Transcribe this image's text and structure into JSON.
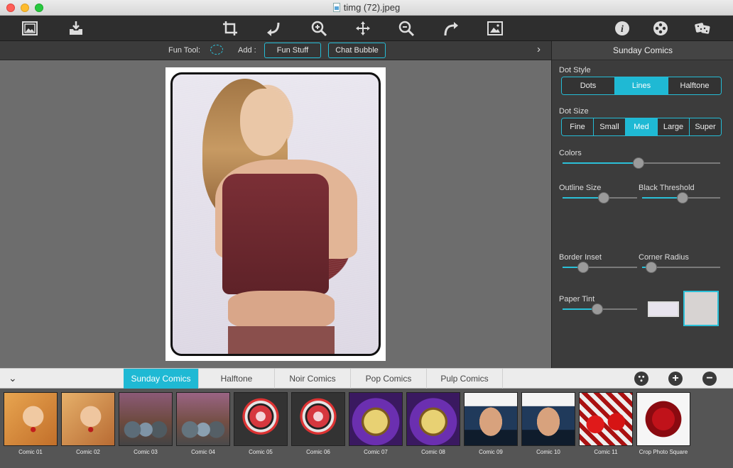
{
  "window": {
    "title": "timg (72).jpeg"
  },
  "toolbar": {
    "icons": [
      "photo-open-icon",
      "save-download-icon",
      "crop-icon",
      "rotate-left-icon",
      "zoom-in-icon",
      "move-icon",
      "zoom-out-icon",
      "rotate-right-icon",
      "fit-image-icon",
      "info-icon",
      "settings-film-icon",
      "random-dice-icon"
    ]
  },
  "funbar": {
    "fun_tool_label": "Fun Tool:",
    "add_label": "Add :",
    "fun_stuff": "Fun Stuff",
    "chat_bubble": "Chat Bubble",
    "expand_glyph": "›"
  },
  "panel": {
    "title": "Sunday Comics",
    "dot_style_label": "Dot Style",
    "dot_style_options": [
      "Dots",
      "Lines",
      "Halftone"
    ],
    "dot_style_selected": "Lines",
    "dot_size_label": "Dot Size",
    "dot_size_options": [
      "Fine",
      "Small",
      "Med",
      "Large",
      "Super"
    ],
    "dot_size_selected": "Med",
    "colors_label": "Colors",
    "colors_value": 0.48,
    "outline_size_label": "Outline Size",
    "outline_size_value": 0.55,
    "black_threshold_label": "Black Threshold",
    "black_threshold_value": 0.52,
    "border_inset_label": "Border Inset",
    "border_inset_value": 0.28,
    "corner_radius_label": "Corner Radius",
    "corner_radius_value": 0.12,
    "paper_tint_label": "Paper Tint",
    "paper_tint_value": 0.47,
    "paper_tint_color": "#e8e4ee",
    "texture_color": "#d7d3d2"
  },
  "tabs": {
    "collapse_glyph": "⌄",
    "items": [
      "Sunday Comics",
      "Halftone",
      "Noir Comics",
      "Pop Comics",
      "Pulp Comics"
    ],
    "active": "Sunday Comics",
    "add_glyph": "+",
    "remove_glyph": "−"
  },
  "thumbnails": [
    {
      "label": "Comic 01",
      "style": "th-face"
    },
    {
      "label": "Comic 02",
      "style": "th-face2"
    },
    {
      "label": "Comic 03",
      "style": "th-cans"
    },
    {
      "label": "Comic 04",
      "style": "th-cans2"
    },
    {
      "label": "Comic 05",
      "style": "th-star"
    },
    {
      "label": "Comic 06",
      "style": "th-star"
    },
    {
      "label": "Comic 07",
      "style": "th-clock"
    },
    {
      "label": "Comic 08",
      "style": "th-clock"
    },
    {
      "label": "Comic 09",
      "style": "th-man"
    },
    {
      "label": "Comic 10",
      "style": "th-man"
    },
    {
      "label": "Comic 11",
      "style": "th-red"
    },
    {
      "label": "Crop Photo Square",
      "style": "th-crop"
    }
  ],
  "colors": {
    "accent": "#1fb9d4"
  }
}
